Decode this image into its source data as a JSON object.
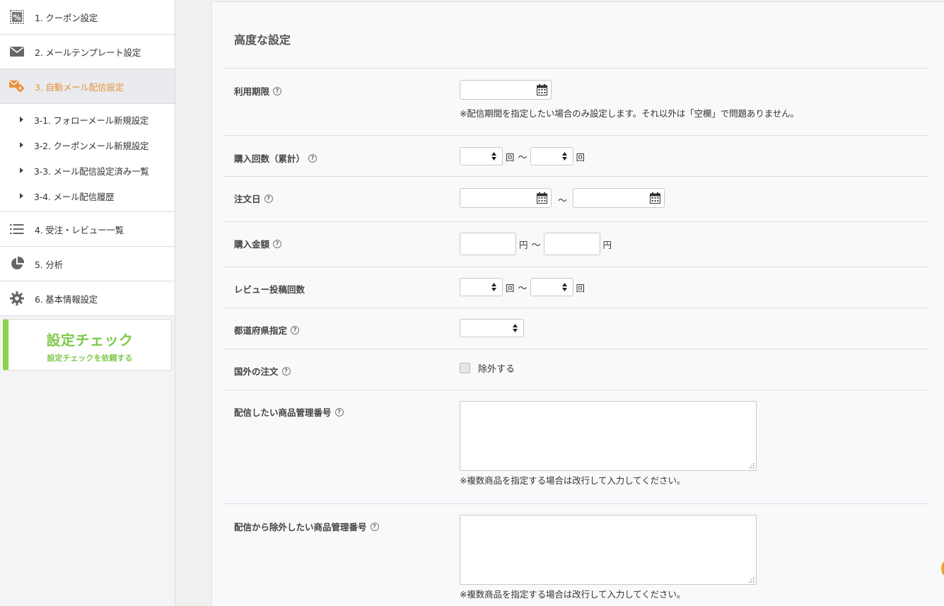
{
  "sidebar": {
    "items": [
      {
        "label": "1. クーポン設定",
        "icon": "coupon-icon"
      },
      {
        "label": "2. メールテンプレート設定",
        "icon": "mail-icon"
      },
      {
        "label": "3. 自動メール配信設定",
        "icon": "mail-gear-icon",
        "active": true
      }
    ],
    "subitems": [
      {
        "label": "3-1. フォローメール新規設定"
      },
      {
        "label": "3-2. クーポンメール新規設定"
      },
      {
        "label": "3-3. メール配信設定済み一覧"
      },
      {
        "label": "3-4. メール配信履歴"
      }
    ],
    "items_after": [
      {
        "label": "4. 受注・レビュー一覧",
        "icon": "list-icon"
      },
      {
        "label": "5. 分析",
        "icon": "pie-chart-icon"
      },
      {
        "label": "6. 基本情報設定",
        "icon": "gear-icon"
      }
    ],
    "check_card": {
      "title": "設定チェック",
      "subtitle": "設定チェックを依頼する"
    }
  },
  "main": {
    "section_title": "高度な設定",
    "fields": {
      "expiry": {
        "label": "利用期限",
        "note": "※配信期間を指定したい場合のみ設定します。それ以外は「空欄」で問題ありません。"
      },
      "purchase_count": {
        "label": "購入回数（累計）",
        "unit": "回",
        "tilde": "〜"
      },
      "order_date": {
        "label": "注文日",
        "tilde": "〜"
      },
      "purchase_amount": {
        "label": "購入金額",
        "unit": "円",
        "tilde": "〜"
      },
      "review_count": {
        "label": "レビュー投稿回数",
        "unit": "回",
        "tilde": "〜"
      },
      "prefecture": {
        "label": "都道府県指定"
      },
      "overseas": {
        "label": "国外の注文",
        "checkbox_label": "除外する"
      },
      "include_products": {
        "label": "配信したい商品管理番号",
        "note": "※複数商品を指定する場合は改行して入力してください。"
      },
      "exclude_products": {
        "label": "配信から除外したい商品管理番号",
        "note": "※複数商品を指定する場合は改行して入力してください。"
      }
    },
    "help_glyph": "?"
  },
  "colors": {
    "accent_orange": "#e8913a",
    "check_green": "#7dc94a"
  }
}
